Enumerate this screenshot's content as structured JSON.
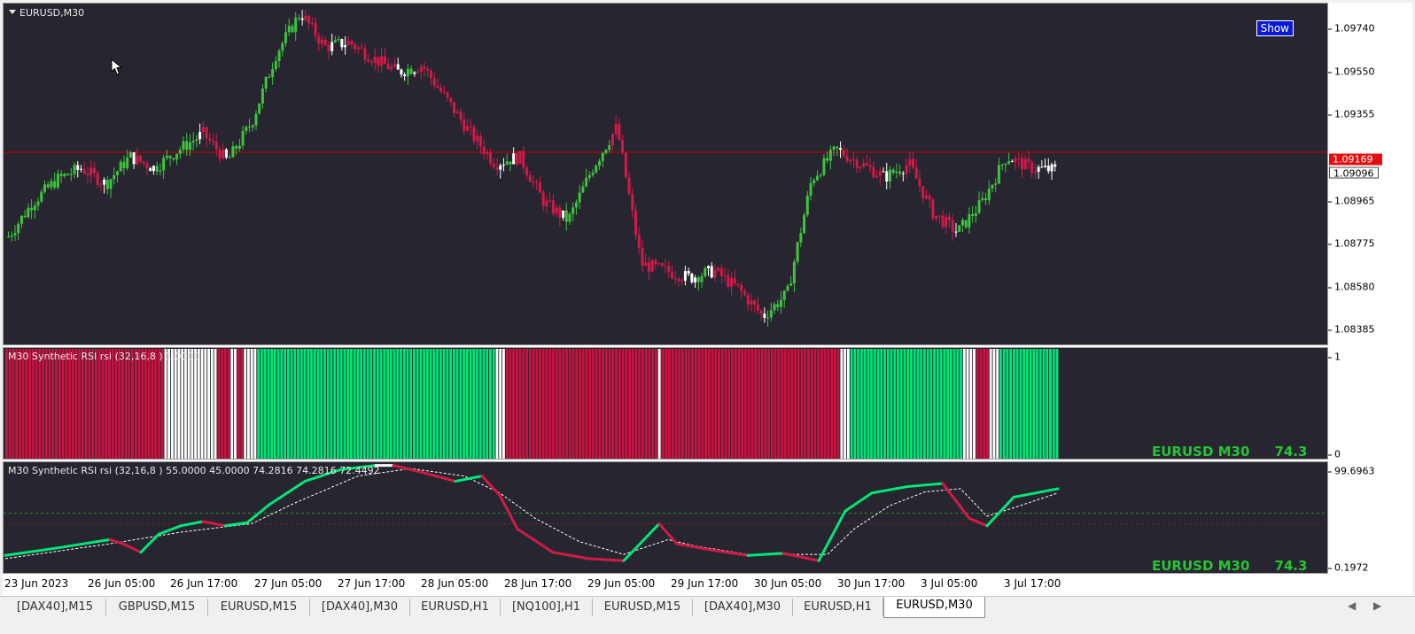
{
  "main_chart": {
    "symbol_label": "EURUSD,M30",
    "show_button": "Show",
    "price_ticks": [
      "1.09740",
      "1.09550",
      "1.09355",
      "1.08965",
      "1.08775",
      "1.08580",
      "1.08385"
    ],
    "red_price_tag": "1.09169",
    "current_price_tag": "1.09096",
    "colors": {
      "background": "#272530",
      "bull": "#3ec43e",
      "bear": "#d11a48",
      "neutral": "#ffffff",
      "hline": "#d00000"
    }
  },
  "histogram_panel": {
    "label": "M30 Synthetic RSI rsi (32,16,8 ) 1.0000",
    "scale_ticks": [
      "1",
      "0"
    ],
    "badge_symbol": "EURUSD M30",
    "badge_value": "74.3",
    "colors": {
      "green": "#00e676",
      "red": "#cc1240",
      "white": "#ffffff"
    }
  },
  "oscillator_panel": {
    "label": "M30 Synthetic RSI rsi (32,16,8 ) 55.0000 45.0000 74.2816 74.2816 72.4492",
    "scale_ticks": [
      "99.6963",
      "0.1972"
    ],
    "badge_symbol": "EURUSD M30",
    "badge_value": "74.3",
    "levels": [
      55,
      45
    ]
  },
  "time_axis": [
    "23 Jun 2023",
    "26 Jun 05:00",
    "26 Jun 17:00",
    "27 Jun 05:00",
    "27 Jun 17:00",
    "28 Jun 05:00",
    "28 Jun 17:00",
    "29 Jun 05:00",
    "29 Jun 17:00",
    "30 Jun 05:00",
    "30 Jun 17:00",
    "3 Jul 05:00",
    "3 Jul 17:00"
  ],
  "tabs": [
    "[DAX40],M15",
    "GBPUSD,M15",
    "EURUSD,M15",
    "[DAX40],M30",
    "EURUSD,H1",
    "[NQ100],H1",
    "EURUSD,M15",
    "[DAX40],M30",
    "EURUSD,H1",
    "EURUSD,M30"
  ],
  "active_tab": "EURUSD,M30",
  "chart_data": {
    "type": "candlestick",
    "symbol": "EURUSD",
    "timeframe": "M30",
    "ylim": [
      1.0832,
      1.0982
    ],
    "x": [
      "23 Jun 2023",
      "26 Jun 05:00",
      "26 Jun 17:00",
      "27 Jun 05:00",
      "27 Jun 17:00",
      "28 Jun 05:00",
      "28 Jun 17:00",
      "29 Jun 05:00",
      "29 Jun 17:00",
      "30 Jun 05:00",
      "30 Jun 17:00",
      "3 Jul 05:00",
      "3 Jul 17:00"
    ],
    "close_path": [
      1.088,
      1.0895,
      1.0905,
      1.091,
      1.0903,
      1.0915,
      1.091,
      1.0918,
      1.0925,
      1.0913,
      1.093,
      1.096,
      1.0978,
      1.0963,
      1.0965,
      1.0958,
      1.0952,
      1.0955,
      1.094,
      1.0925,
      1.0912,
      1.0915,
      1.0895,
      1.0887,
      1.091,
      1.0928,
      1.0868,
      1.0865,
      1.0862,
      1.0865,
      1.0857,
      1.0845,
      1.0855,
      1.0905,
      1.0918,
      1.0912,
      1.0906,
      1.0912,
      1.089,
      1.0882,
      1.0895,
      1.0915,
      1.091,
      1.0909
    ],
    "last_price": 1.09096,
    "horizontal_line": 1.09169
  }
}
